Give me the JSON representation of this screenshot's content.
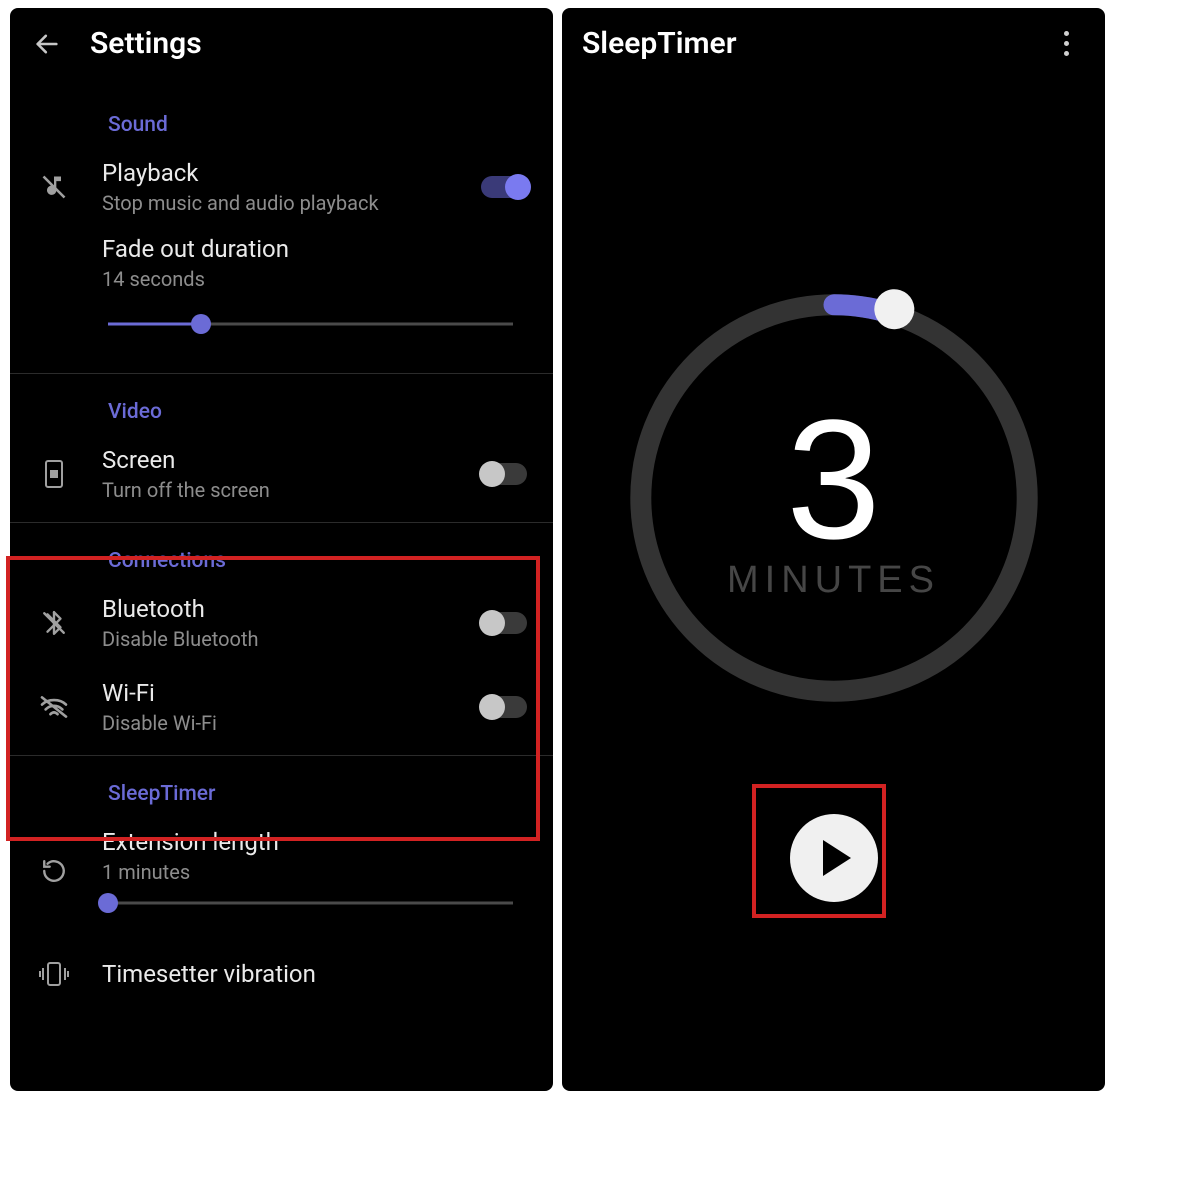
{
  "left": {
    "title": "Settings",
    "sections": {
      "sound": {
        "label": "Sound",
        "playback": {
          "title": "Playback",
          "sub": "Stop music and audio playback",
          "on": true
        },
        "fade": {
          "title": "Fade out duration",
          "sub": "14 seconds",
          "slider_pct": 23
        }
      },
      "video": {
        "label": "Video",
        "screen": {
          "title": "Screen",
          "sub": "Turn off the screen",
          "on": false
        }
      },
      "connections": {
        "label": "Connections",
        "bluetooth": {
          "title": "Bluetooth",
          "sub": "Disable Bluetooth",
          "on": false
        },
        "wifi": {
          "title": "Wi-Fi",
          "sub": "Disable Wi-Fi",
          "on": false
        }
      },
      "sleeptimer": {
        "label": "SleepTimer",
        "extension": {
          "title": "Extension length",
          "sub": "1 minutes",
          "slider_pct": 0
        },
        "vibration": {
          "title": "Timesetter vibration"
        }
      }
    }
  },
  "right": {
    "title": "SleepTimer",
    "timer_value": "3",
    "timer_unit": "MINUTES",
    "progress_pct": 5
  },
  "colors": {
    "accent": "#6b6bd6",
    "highlight": "#d22222"
  }
}
